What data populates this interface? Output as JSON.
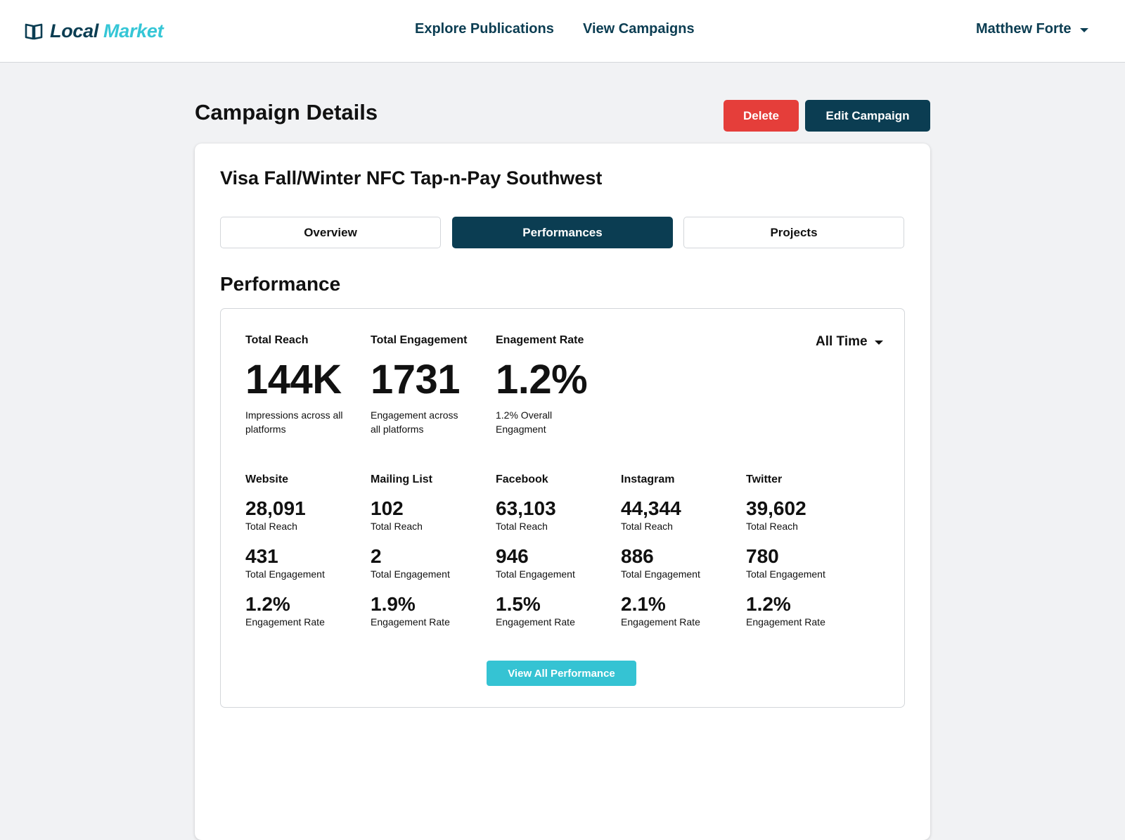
{
  "header": {
    "logo_part1": "Local",
    "logo_part2": "Market",
    "nav": [
      "Explore Publications",
      "View Campaigns"
    ],
    "user_name": "Matthew Forte"
  },
  "page": {
    "title": "Campaign Details",
    "delete_label": "Delete",
    "edit_label": "Edit Campaign"
  },
  "campaign": {
    "name": "Visa Fall/Winter NFC Tap-n-Pay Southwest",
    "tabs": [
      "Overview",
      "Performances",
      "Projects"
    ],
    "active_tab": "Performances"
  },
  "performance": {
    "section_title": "Performance",
    "period": "All Time",
    "kpis": [
      {
        "label": "Total Reach",
        "value": "144K",
        "desc": "Impressions across all platforms"
      },
      {
        "label": "Total Engagement",
        "value": "1731",
        "desc": "Engagement across all platforms"
      },
      {
        "label": "Enagement Rate",
        "value": "1.2%",
        "desc": "1.2% Overall Engagment"
      }
    ],
    "reach_label": "Total Reach",
    "engagement_label": "Total Engagement",
    "rate_label": "Engagement Rate",
    "channels": [
      {
        "name": "Website",
        "reach": "28,091",
        "engagement": "431",
        "rate": "1.2%"
      },
      {
        "name": "Mailing List",
        "reach": "102",
        "engagement": "2",
        "rate": "1.9%"
      },
      {
        "name": "Facebook",
        "reach": "63,103",
        "engagement": "946",
        "rate": "1.5%"
      },
      {
        "name": "Instagram",
        "reach": "44,344",
        "engagement": "886",
        "rate": "2.1%"
      },
      {
        "name": "Twitter",
        "reach": "39,602",
        "engagement": "780",
        "rate": "1.2%"
      }
    ],
    "view_all_label": "View All Performance"
  },
  "colors": {
    "brand_dark": "#0b3d52",
    "brand_accent": "#35c6d6",
    "danger": "#e53e3a",
    "background": "#f1f2f4"
  }
}
